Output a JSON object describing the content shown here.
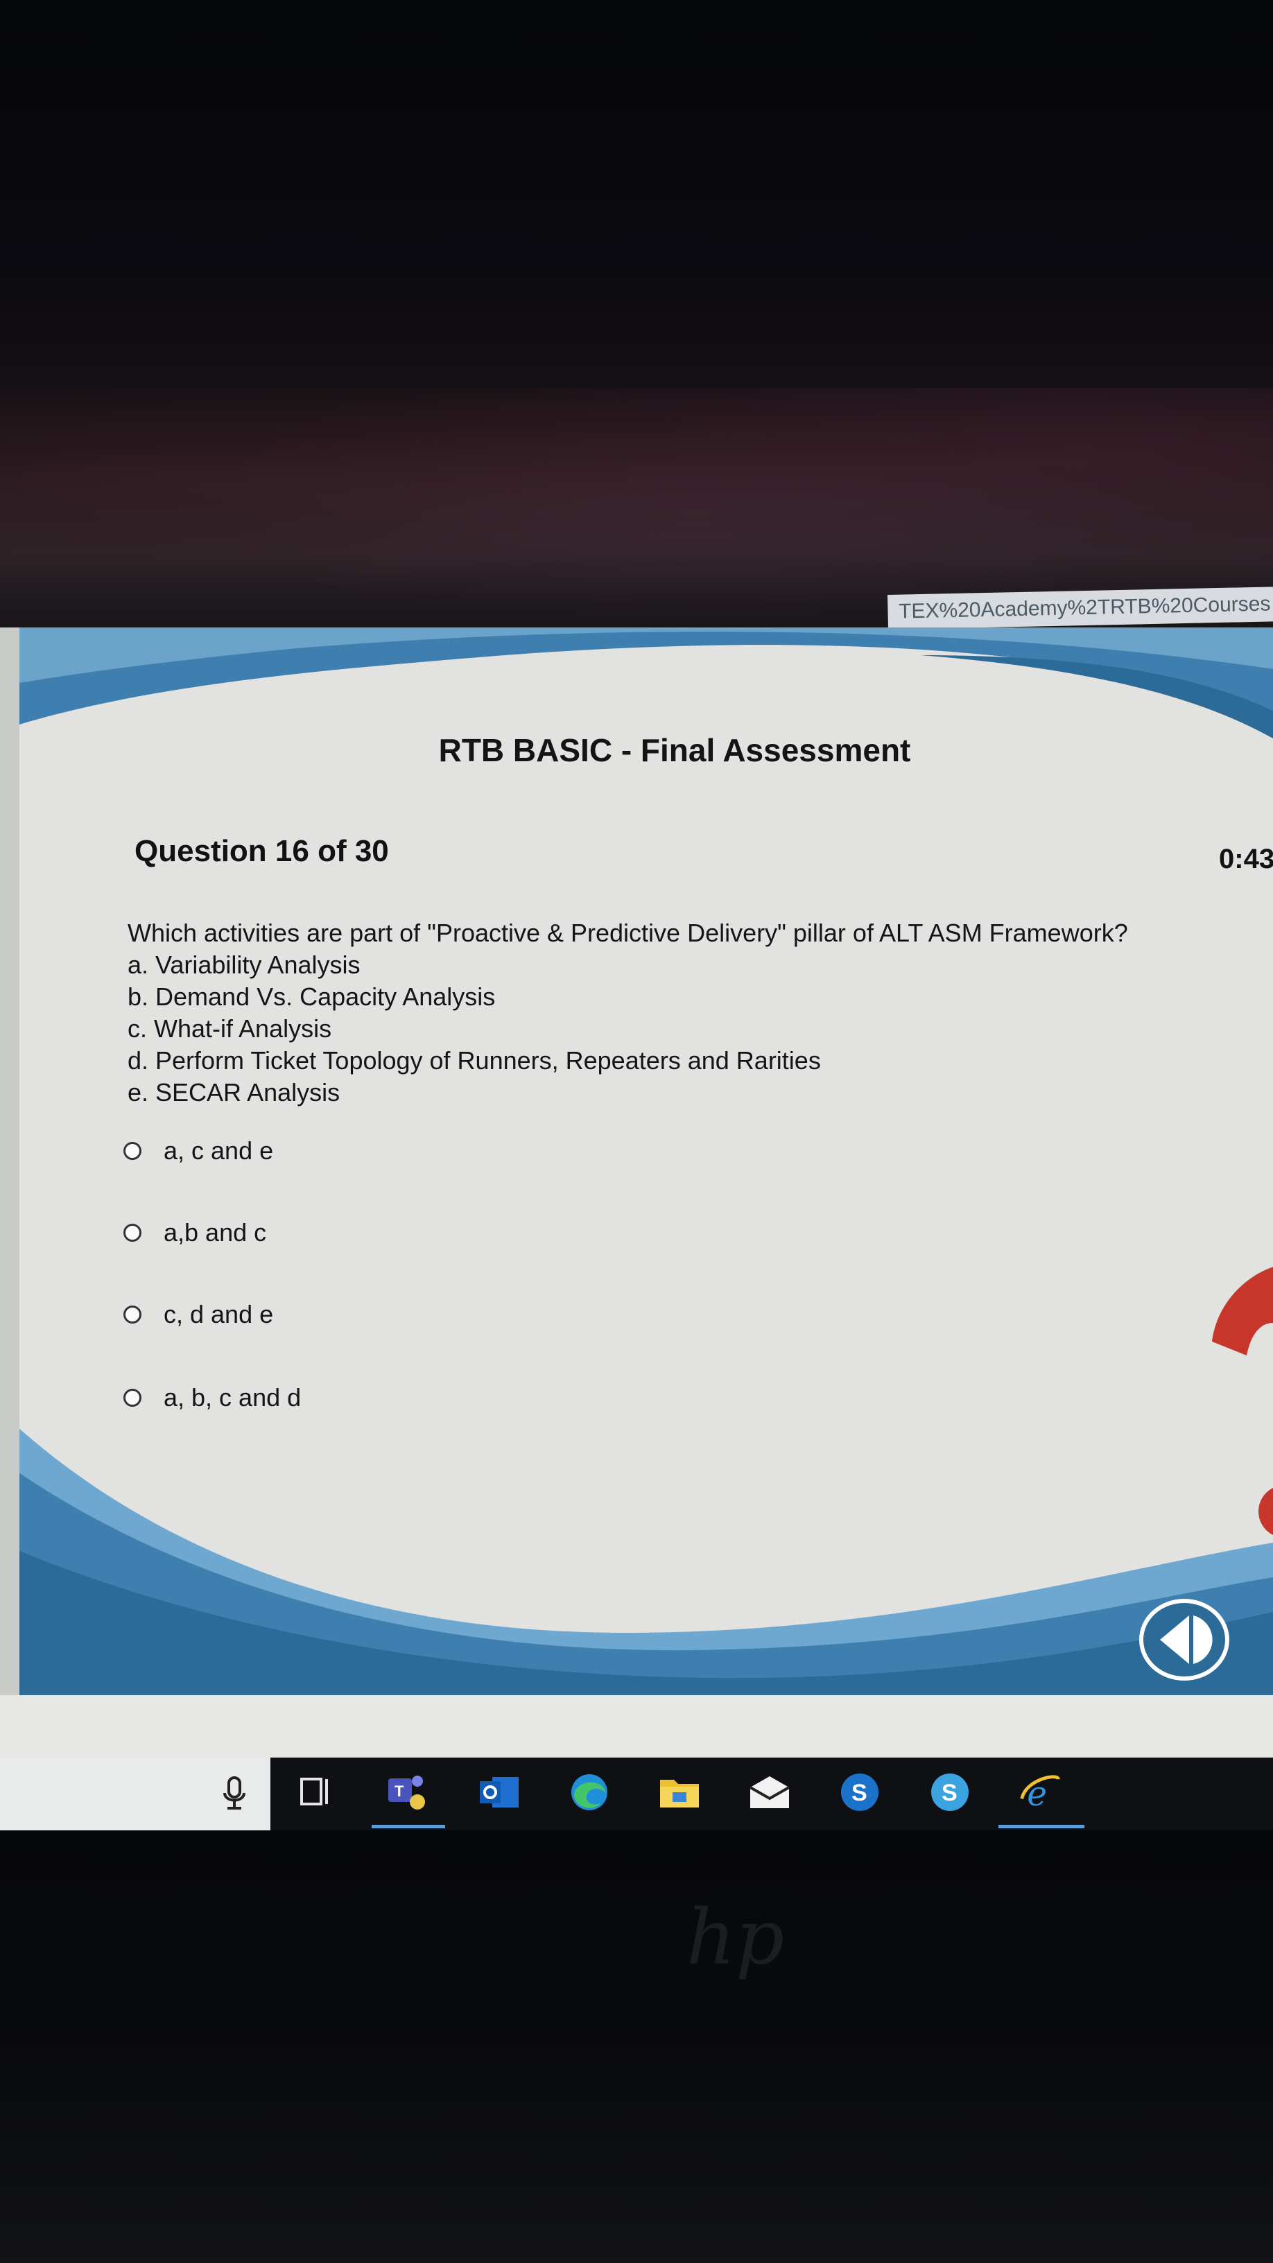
{
  "browser": {
    "url_fragment": "TEX%20Academy%2TRTB%20Courses"
  },
  "quiz": {
    "title": "RTB BASIC - Final Assessment",
    "question_number": "Question 16 of 30",
    "timer": "0:43",
    "question_lines": [
      "Which activities are part of \"Proactive & Predictive Delivery\" pillar of ALT ASM Framework?",
      "a. Variability Analysis",
      "b. Demand Vs. Capacity Analysis",
      "c. What-if Analysis",
      "d. Perform Ticket Topology of Runners, Repeaters and Rarities",
      "e. SECAR Analysis"
    ],
    "options": [
      {
        "label": "a, c and e",
        "selected": false
      },
      {
        "label": "a,b and c",
        "selected": false
      },
      {
        "label": "c, d and e",
        "selected": false
      },
      {
        "label": "a, b, c and d",
        "selected": false
      }
    ]
  },
  "taskbar": {
    "icons": [
      "microphone-icon",
      "task-view-icon",
      "teams-icon",
      "outlook-icon",
      "edge-icon",
      "file-explorer-icon",
      "mail-icon",
      "skype-for-business-icon",
      "skype-icon",
      "internet-explorer-icon"
    ]
  },
  "colors": {
    "slide_blue": "#3f7fb0",
    "slide_blue_light": "#7fb2d6",
    "question_mark_red": "#c8352a",
    "taskbar_accent": "#5aa0dc"
  }
}
